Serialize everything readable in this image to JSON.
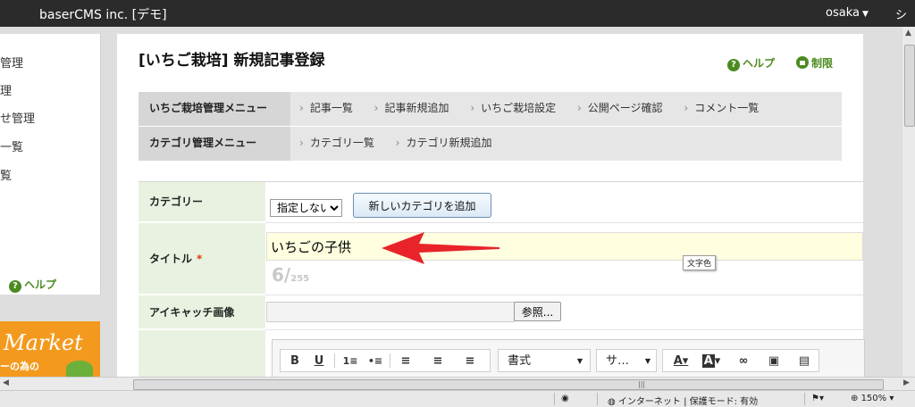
{
  "topbar": {
    "site_name": "baserCMS inc. [デモ]",
    "user": "osaka",
    "cut_text": "シ"
  },
  "sidebar": {
    "items": [
      "管理",
      "理",
      "せ管理",
      "一覧",
      "覧"
    ],
    "help": "ヘルプ",
    "banner_text": "Market",
    "banner_sub": "ーの為の"
  },
  "page": {
    "title": "[いちご栽培] 新規記事登録",
    "help_link": "ヘルプ",
    "restrict_link": "制限"
  },
  "menus": [
    {
      "title": "いちご栽培管理メニュー",
      "links": [
        "記事一覧",
        "記事新規追加",
        "いちご栽培設定",
        "公開ページ確認",
        "コメント一覧"
      ]
    },
    {
      "title": "カテゴリ管理メニュー",
      "links": [
        "カテゴリ一覧",
        "カテゴリ新規追加"
      ]
    }
  ],
  "form": {
    "category_label": "カテゴリー",
    "category_value": "指定しない",
    "add_category_button": "新しいカテゴリを追加",
    "title_label": "タイトル",
    "required_mark": "*",
    "title_value": "いちごの子供",
    "tooltip": "文字色",
    "counter_current": "6/",
    "counter_max": "255",
    "eyecatch_label": "アイキャッチ画像",
    "browse_button": "参照..."
  },
  "editor": {
    "format_label": "書式",
    "size_label": "サ…",
    "buttons": [
      "bold-icon",
      "underline-icon",
      "ordered-list-icon",
      "bullet-list-icon",
      "align-left-icon",
      "align-center-icon",
      "align-right-icon",
      "text-color-icon",
      "bg-color-icon",
      "link-icon",
      "image-icon",
      "template-icon"
    ]
  },
  "status": {
    "zone": "インターネット | 保護モード: 有効",
    "zoom": "150%"
  },
  "colors": {
    "topbar": "#2b2b2b",
    "accent_green": "#4b8b1f",
    "label_bg": "#e9f2e0",
    "title_input_bg": "#ffffe0",
    "arrow_red": "#e8242a"
  }
}
